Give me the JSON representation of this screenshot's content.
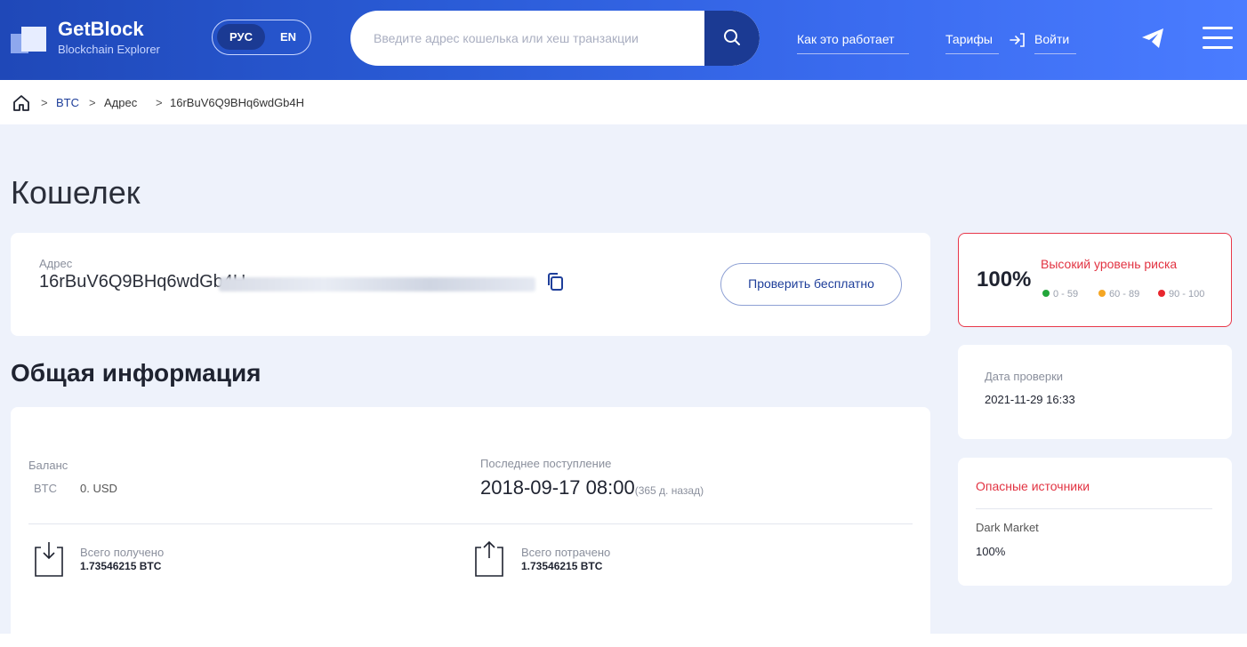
{
  "header": {
    "logo_title": "GetBlock",
    "logo_subtitle": "Blockchain Explorer",
    "lang_active": "РУС",
    "lang_other": "EN",
    "search_placeholder": "Введите адрес кошелька или хеш транзакции",
    "nav_how": "Как это работает",
    "nav_tariffs": "Тарифы",
    "nav_login": "Войти",
    "accent": "#1b3a93"
  },
  "breadcrumb": {
    "coin": "BTC",
    "section": "Адрес",
    "address": "16rBuV6Q9BHq6wdGb4H"
  },
  "page": {
    "title": "Кошелек"
  },
  "address_card": {
    "label": "Адрес",
    "address": "16rBuV6Q9BHq6wdGb4H",
    "check_button": "Проверить бесплатно"
  },
  "general": {
    "title": "Общая информация",
    "balance_label": "Баланс",
    "balance_unit": "BTC",
    "balance_value": "0. USD",
    "last_label": "Последнее поступление",
    "last_date": "2018-09-17 08:00",
    "last_ago": "(365 д. назад)",
    "received_label": "Всего получено",
    "received_value": "1.73546215 BTC",
    "spent_label": "Всего потрачено",
    "spent_value": "1.73546215 BTC"
  },
  "risk": {
    "percent": "100%",
    "level": "Высокий уровень риска",
    "legend": [
      {
        "range": "0 - 59",
        "color": "#22a63a"
      },
      {
        "range": "60 - 89",
        "color": "#f5a623"
      },
      {
        "range": "90 - 100",
        "color": "#e8262e"
      }
    ],
    "border_color": "#e8384a"
  },
  "check_date": {
    "label": "Дата проверки",
    "value": "2021-11-29 16:33"
  },
  "sources": {
    "title": "Опасные источники",
    "name": "Dark Market",
    "value": "100%"
  }
}
